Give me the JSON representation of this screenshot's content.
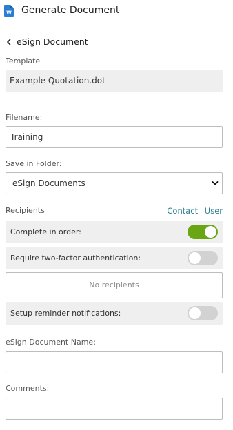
{
  "header": {
    "title": "Generate Document",
    "icon": "word-document-icon",
    "icon_color": "#2b7cd3"
  },
  "nav": {
    "back_label": "eSign Document"
  },
  "template": {
    "label": "Template",
    "value": "Example Quotation.dot"
  },
  "filename": {
    "label": "Filename:",
    "value": "Training"
  },
  "folder": {
    "label": "Save in Folder:",
    "selected": "eSign Documents"
  },
  "recipients": {
    "label": "Recipients",
    "links": [
      "Contact",
      "User"
    ],
    "link_color": "#2a7d8f",
    "empty_text": "No recipients"
  },
  "options": {
    "complete_in_order": {
      "label": "Complete in order:",
      "enabled": true
    },
    "two_factor": {
      "label": "Require two-factor authentication:",
      "enabled": false
    },
    "reminders": {
      "label": "Setup reminder notifications:",
      "enabled": false
    },
    "toggle_on_color": "#6aa514"
  },
  "esign_name": {
    "label": "eSign Document Name:",
    "value": ""
  },
  "comments": {
    "label": "Comments:",
    "value": ""
  }
}
